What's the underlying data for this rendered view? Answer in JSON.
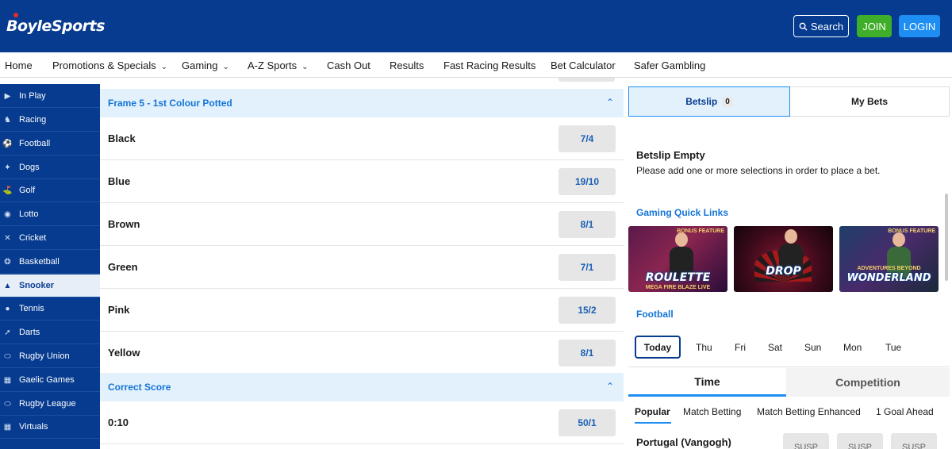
{
  "header": {
    "logo": "BoyleSports",
    "search_label": "Search",
    "join_label": "JOIN",
    "login_label": "LOGIN"
  },
  "nav": {
    "items": [
      {
        "label": "Home"
      },
      {
        "label": "Promotions & Specials"
      },
      {
        "label": "Gaming"
      },
      {
        "label": "A-Z Sports"
      },
      {
        "label": "Cash Out"
      },
      {
        "label": "Results"
      },
      {
        "label": "Fast Racing Results"
      },
      {
        "label": "Bet Calculator"
      },
      {
        "label": "Safer Gambling"
      }
    ]
  },
  "sidebar": {
    "items": [
      {
        "label": "In Play",
        "icon": "play-icon"
      },
      {
        "label": "Racing",
        "icon": "horse-icon"
      },
      {
        "label": "Football",
        "icon": "football-icon"
      },
      {
        "label": "Dogs",
        "icon": "dog-icon"
      },
      {
        "label": "Golf",
        "icon": "golf-icon"
      },
      {
        "label": "Lotto",
        "icon": "lotto-icon"
      },
      {
        "label": "Cricket",
        "icon": "cricket-icon"
      },
      {
        "label": "Basketball",
        "icon": "basketball-icon"
      },
      {
        "label": "Snooker",
        "icon": "snooker-icon",
        "active": true
      },
      {
        "label": "Tennis",
        "icon": "tennis-icon"
      },
      {
        "label": "Darts",
        "icon": "darts-icon"
      },
      {
        "label": "Rugby Union",
        "icon": "rugby-union-icon"
      },
      {
        "label": "Gaelic Games",
        "icon": "gaelic-icon"
      },
      {
        "label": "Rugby League",
        "icon": "rugby-league-icon"
      },
      {
        "label": "Virtuals",
        "icon": "virtuals-icon"
      }
    ]
  },
  "markets": [
    {
      "title": "Frame 5 - 1st Colour Potted",
      "selections": [
        {
          "name": "Black",
          "price": "7/4"
        },
        {
          "name": "Blue",
          "price": "19/10"
        },
        {
          "name": "Brown",
          "price": "8/1"
        },
        {
          "name": "Green",
          "price": "7/1"
        },
        {
          "name": "Pink",
          "price": "15/2"
        },
        {
          "name": "Yellow",
          "price": "8/1"
        }
      ]
    },
    {
      "title": "Correct Score",
      "selections": [
        {
          "name": "0:10",
          "price": "50/1"
        }
      ]
    }
  ],
  "betslip": {
    "tab_label": "Betslip",
    "count": "0",
    "mybets_label": "My Bets",
    "empty_title": "Betslip Empty",
    "empty_text": "Please add one or more selections in order to place a bet."
  },
  "gaming": {
    "title": "Gaming Quick Links",
    "games": [
      {
        "title": "ROULETTE",
        "subtitle": "MEGA FIRE BLAZE LIVE",
        "badge": "BONUS FEATURE"
      },
      {
        "title": "DROP",
        "subtitle": "",
        "badge": ""
      },
      {
        "title": "WONDERLAND",
        "subtitle": "ADVENTURES BEYOND",
        "badge": "BONUS FEATURE"
      }
    ]
  },
  "football": {
    "title": "Football",
    "days": [
      "Today",
      "Thu",
      "Fri",
      "Sat",
      "Sun",
      "Mon",
      "Tue"
    ],
    "toggle": {
      "time": "Time",
      "competition": "Competition"
    },
    "sub_tabs": [
      "Popular",
      "Match Betting",
      "Match Betting Enhanced",
      "1 Goal Ahead"
    ],
    "match": {
      "name": "Portugal (Vangogh)",
      "prices": [
        "SUSP",
        "SUSP",
        "SUSP"
      ]
    }
  },
  "colors": {
    "brand_blue": "#063b8f",
    "join_green": "#3fae29",
    "login_blue": "#1e8ef2",
    "link_blue": "#1374d6",
    "market_header_bg": "#e3f1fc"
  }
}
